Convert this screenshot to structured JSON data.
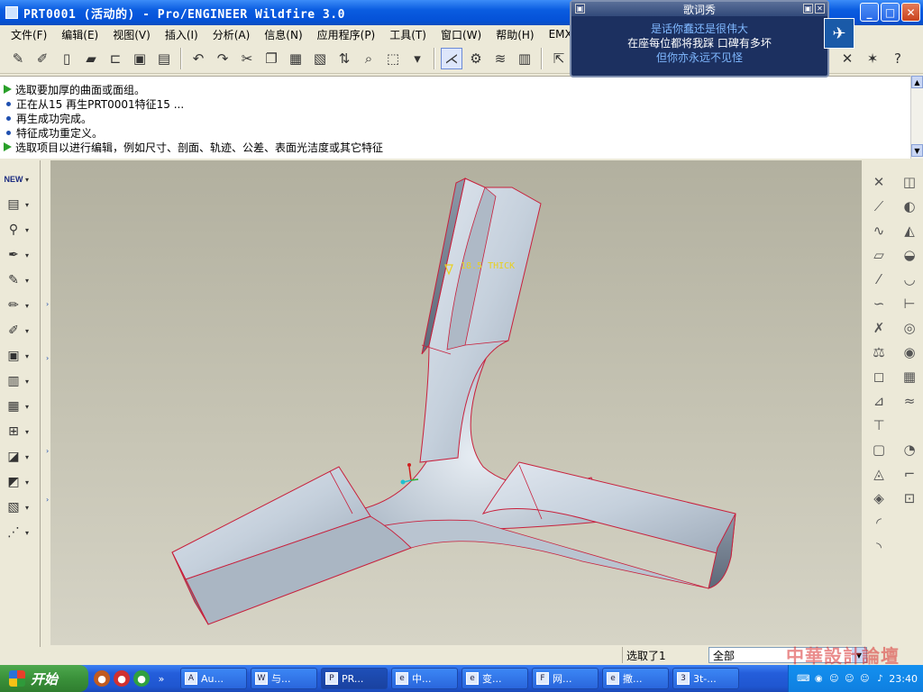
{
  "window": {
    "title": "PRT0001 (活动的) - Pro/ENGINEER Wildfire 3.0",
    "controls": {
      "minimize": "_",
      "maximize": "□",
      "close": "✕"
    }
  },
  "menu": [
    "文件(F)",
    "编辑(E)",
    "视图(V)",
    "插入(I)",
    "分析(A)",
    "信息(N)",
    "应用程序(P)",
    "工具(T)",
    "窗口(W)",
    "帮助(H)",
    "EMX 4.0"
  ],
  "toolbar": {
    "icons": [
      "new-file-icon",
      "open-icon",
      "save-icon",
      "save-copy-icon",
      "undo-icon",
      "redo-icon",
      "cut-icon",
      "copy-icon",
      "paste-icon",
      "paste-special-icon",
      "regenerate-icon",
      "find-icon",
      "select-box-icon",
      "datum-display-icon",
      "view-icon",
      "layers-icon",
      "model-tree-icon",
      "cursor-icon"
    ]
  },
  "messages": [
    {
      "kind": "prompt",
      "text": "选取要加厚的曲面或面组。"
    },
    {
      "kind": "info",
      "text": "正在从15 再生PRT0001特征15 ..."
    },
    {
      "kind": "info",
      "text": "再生成功完成。"
    },
    {
      "kind": "info",
      "text": "特征成功重定义。"
    },
    {
      "kind": "prompt",
      "text": "选取项目以进行编辑，例如尺寸、剖面、轨迹、公差、表面光洁度或其它特征"
    }
  ],
  "left_tools": {
    "new_label": "NEW",
    "icons": [
      "new-icon",
      "extrude-icon",
      "revolve-icon",
      "sweep-icon",
      "blend-icon",
      "hole-icon",
      "round-icon",
      "shell-icon",
      "rib-icon",
      "draft-icon",
      "pattern-icon",
      "mirror-icon",
      "merge-icon",
      "trim-icon",
      "thicken-icon"
    ]
  },
  "right_tools": {
    "icons": [
      "datum-point-icon",
      "datum-plane-icon",
      "datum-axis-icon",
      "sketch-icon",
      "datum-curve-icon",
      "csys-icon",
      "analysis-icon",
      "chamfer-icon",
      "draft-check-icon",
      "offset-icon",
      "extend-icon",
      "intersect-icon",
      "wrap-icon",
      "fill-icon",
      "style-icon",
      "boundary-icon",
      "variable-section-icon",
      "warp-icon"
    ]
  },
  "model": {
    "annotation": "18.5 THICK"
  },
  "status": {
    "selection": "选取了1",
    "filter": "全部"
  },
  "taskbar": {
    "start": "开始",
    "tasks": [
      {
        "icon": "A",
        "label": "Au...",
        "active": false
      },
      {
        "icon": "W",
        "label": "与...",
        "active": false
      },
      {
        "icon": "P",
        "label": "PR...",
        "active": true
      },
      {
        "icon": "e",
        "label": "中...",
        "active": false
      },
      {
        "icon": "e",
        "label": "变...",
        "active": false
      },
      {
        "icon": "F",
        "label": "网...",
        "active": false
      },
      {
        "icon": "e",
        "label": "撒...",
        "active": false
      },
      {
        "icon": "3",
        "label": "3t-...",
        "active": false
      }
    ],
    "clock": "23:40"
  },
  "lyrics": {
    "title": "歌词秀",
    "lines": [
      "是话你蠢还是很伟大",
      "在座每位都将我踩  口碑有多坏",
      "但你亦永远不见怪"
    ]
  },
  "watermark": "中華設計論壇"
}
